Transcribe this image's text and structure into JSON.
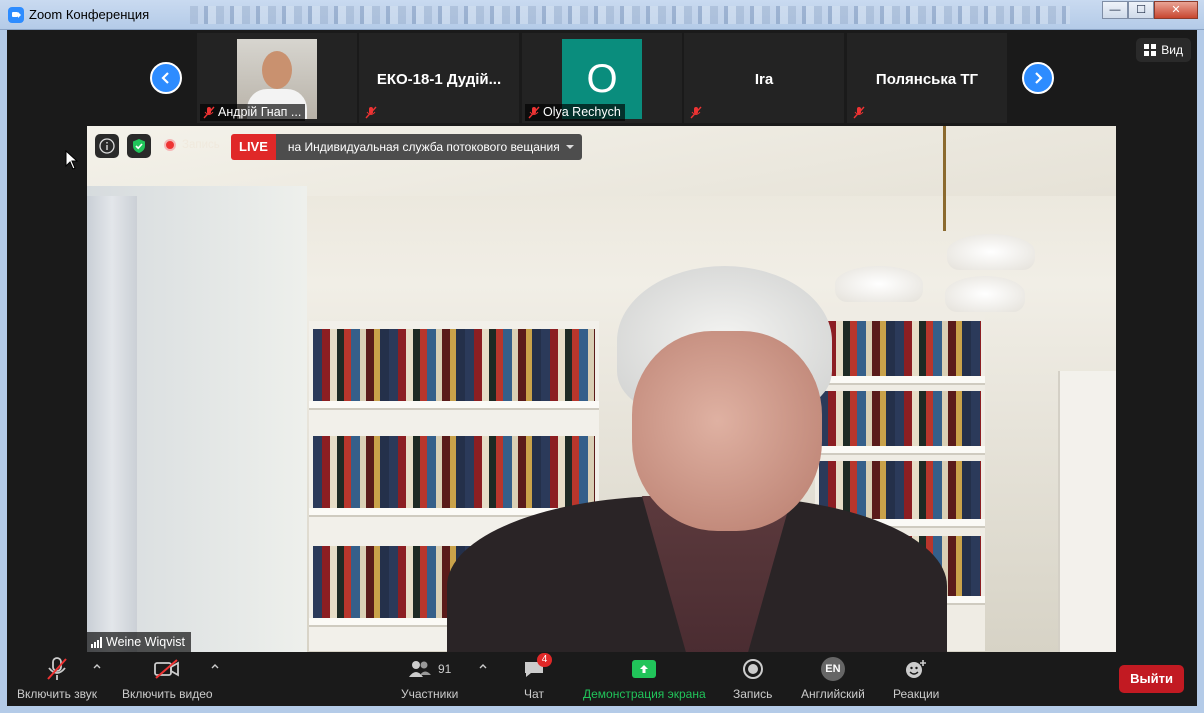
{
  "window": {
    "title": "Zoom Конференция",
    "minimize": "—",
    "maximize": "☐",
    "close": "✕"
  },
  "view_button": {
    "label": "Вид"
  },
  "thumbnails": [
    {
      "name": "Андрій Гнап ...",
      "video": "photo",
      "muted": true
    },
    {
      "name": "ЕКО-18-1 Дудій...",
      "video": "off",
      "muted": true
    },
    {
      "name": "Olya Rechych",
      "video": "letter",
      "letter": "O",
      "muted": true
    },
    {
      "name": "Ira",
      "video": "off",
      "muted": true
    },
    {
      "name": "Полянська ТГ",
      "video": "off",
      "muted": true
    }
  ],
  "overlay": {
    "recording_label": "Запись",
    "live_badge": "LIVE",
    "live_target": "на Индивидуальная служба потокового вещания"
  },
  "speaker": {
    "name": "Weine Wiqvist"
  },
  "toolbar": {
    "unmute": "Включить звук",
    "start_video": "Включить видео",
    "participants": "Участники",
    "participants_count": "91",
    "chat": "Чат",
    "chat_badge": "4",
    "share_screen": "Демонстрация экрана",
    "record": "Запись",
    "language": "Английский",
    "language_code": "EN",
    "reactions": "Реакции",
    "leave": "Выйти"
  },
  "colors": {
    "accent": "#2d8cff",
    "live": "#e02828",
    "share_green": "#21c45a",
    "leave_red": "#c21a22",
    "avatar_teal": "#0a8d7d"
  }
}
